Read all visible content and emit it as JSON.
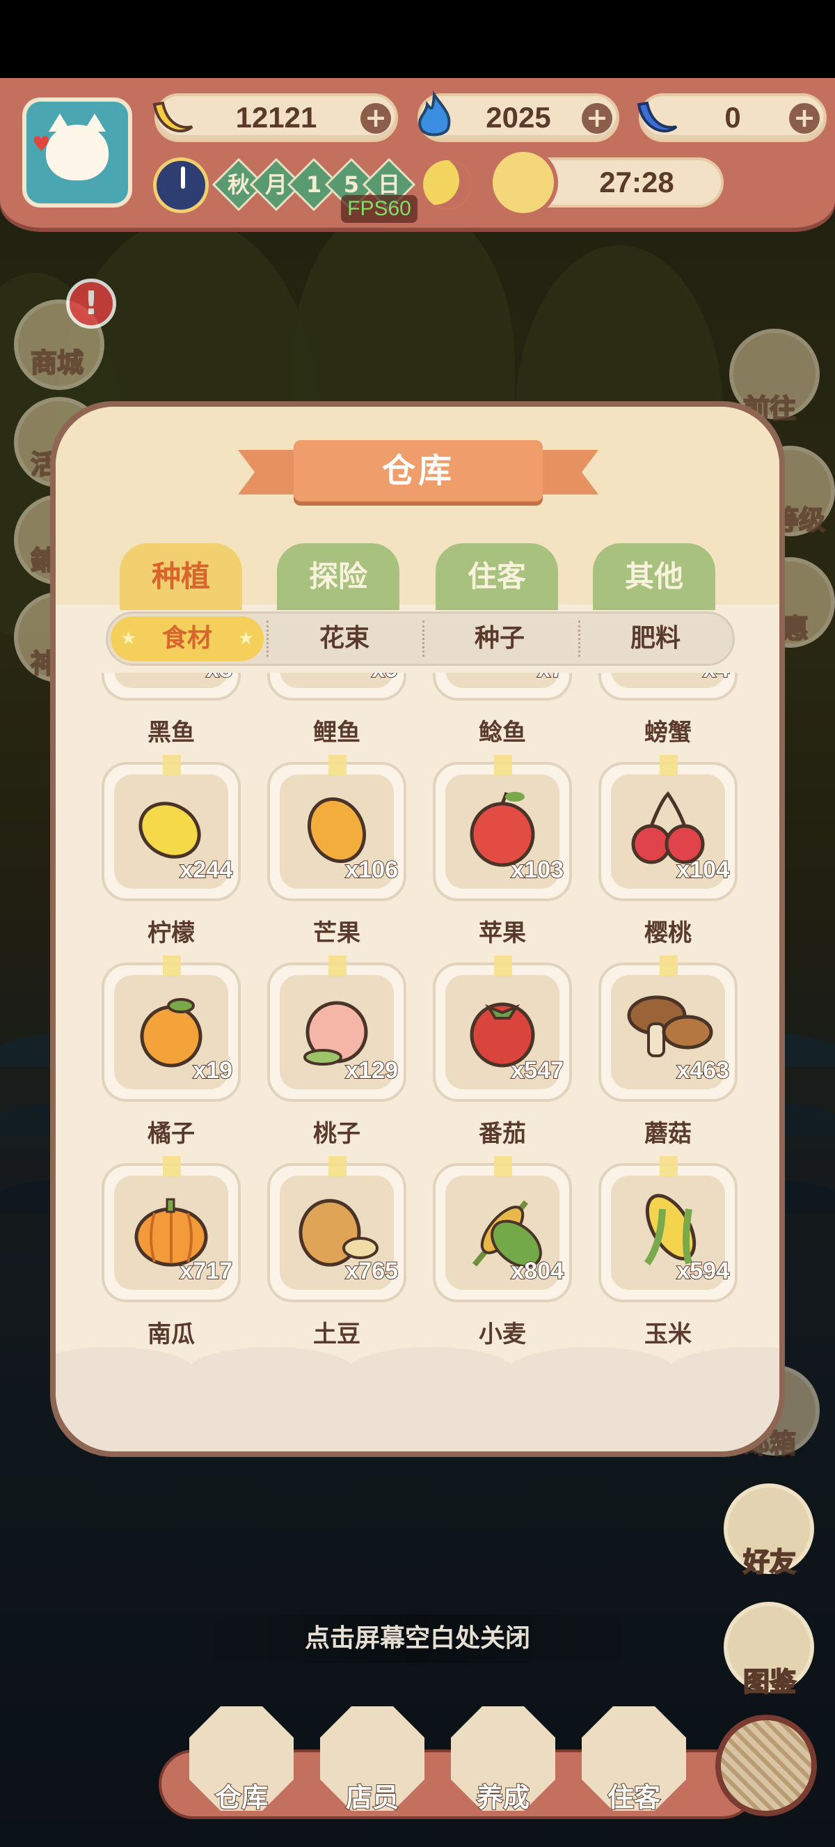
{
  "hud": {
    "bananas": "12121",
    "flames": "2025",
    "blue_bananas": "0",
    "plus": "+",
    "date_chars": [
      "秋",
      "月",
      "1",
      "5",
      "日"
    ],
    "timer": "27:28",
    "fps": "FPS60"
  },
  "side_left": {
    "shop_label": "商城",
    "badge": "!",
    "activity_label": "活",
    "partial_3": "鋪",
    "partial_4": "神"
  },
  "side_right": {
    "goto_label": "前往",
    "level_label": "等级",
    "partial_label": "惠",
    "mailbox_label": "邮箱",
    "friends_label": "好友",
    "codex_label": "图鉴"
  },
  "panel": {
    "title": "仓库",
    "tabs": [
      {
        "label": "种植",
        "active": true
      },
      {
        "label": "探险",
        "active": false
      },
      {
        "label": "住客",
        "active": false
      },
      {
        "label": "其他",
        "active": false
      }
    ],
    "subtabs": [
      {
        "label": "食材",
        "active": true
      },
      {
        "label": "花束",
        "active": false
      },
      {
        "label": "种子",
        "active": false
      },
      {
        "label": "肥料",
        "active": false
      }
    ],
    "items": [
      {
        "name": "黑鱼",
        "qty": "x3",
        "icon": "black-fish"
      },
      {
        "name": "鲤鱼",
        "qty": "x9",
        "icon": "carp"
      },
      {
        "name": "鲶鱼",
        "qty": "x7",
        "icon": "catfish"
      },
      {
        "name": "螃蟹",
        "qty": "x4",
        "icon": "crab"
      },
      {
        "name": "柠檬",
        "qty": "x244",
        "icon": "lemon"
      },
      {
        "name": "芒果",
        "qty": "x106",
        "icon": "mango"
      },
      {
        "name": "苹果",
        "qty": "x103",
        "icon": "apple"
      },
      {
        "name": "樱桃",
        "qty": "x104",
        "icon": "cherry"
      },
      {
        "name": "橘子",
        "qty": "x19",
        "icon": "orange"
      },
      {
        "name": "桃子",
        "qty": "x129",
        "icon": "peach"
      },
      {
        "name": "番茄",
        "qty": "x547",
        "icon": "tomato"
      },
      {
        "name": "蘑菇",
        "qty": "x463",
        "icon": "mushroom"
      },
      {
        "name": "南瓜",
        "qty": "x717",
        "icon": "pumpkin"
      },
      {
        "name": "土豆",
        "qty": "x765",
        "icon": "potato"
      },
      {
        "name": "小麦",
        "qty": "x804",
        "icon": "wheat"
      },
      {
        "name": "玉米",
        "qty": "x594",
        "icon": "corn"
      }
    ]
  },
  "close_hint": "点击屏幕空白处关闭",
  "nav": {
    "warehouse": "仓库",
    "staff": "店员",
    "nurture": "养成",
    "guests": "住客"
  }
}
